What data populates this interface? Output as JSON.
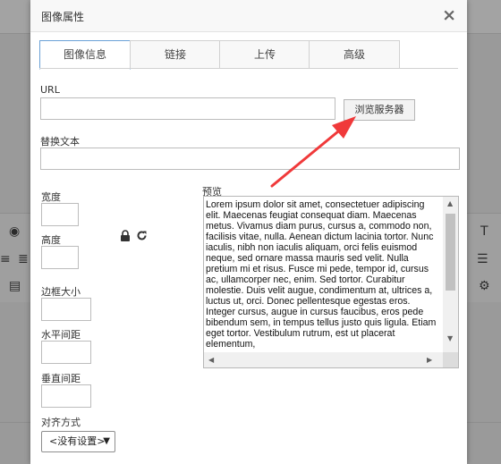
{
  "dialog": {
    "title": "图像属性",
    "close_glyph": "×"
  },
  "tabs": [
    {
      "label": "图像信息",
      "active": true
    },
    {
      "label": "链接",
      "active": false
    },
    {
      "label": "上传",
      "active": false
    },
    {
      "label": "高级",
      "active": false
    }
  ],
  "form": {
    "url_label": "URL",
    "url_value": "",
    "browse_button": "浏览服务器",
    "alt_label": "替换文本",
    "alt_value": "",
    "width_label": "宽度",
    "height_label": "高度",
    "border_label": "边框大小",
    "hspace_label": "水平间距",
    "vspace_label": "垂直间距",
    "align_label": "对齐方式",
    "align_selected": "<没有设置>",
    "preview_label": "预览",
    "preview_text": "Lorem ipsum dolor sit amet, consectetuer adipiscing elit. Maecenas feugiat consequat diam. Maecenas metus. Vivamus diam purus, cursus a, commodo non, facilisis vitae, nulla. Aenean dictum lacinia tortor. Nunc iaculis, nibh non iaculis aliquam, orci felis euismod neque, sed ornare massa mauris sed velit. Nulla pretium mi et risus. Fusce mi pede, tempor id, cursus ac, ullamcorper nec, enim. Sed tortor. Curabitur molestie. Duis velit augue, condimentum at, ultrices a, luctus ut, orci. Donec pellentesque egestas eros. Integer cursus, augue in cursus faucibus, eros pede bibendum sem, in tempus tellus justo quis ligula. Etiam eget tortor. Vestibulum rutrum, est ut placerat elementum,"
  },
  "icons": {
    "lock": "lock-icon",
    "reset": "refresh-icon"
  },
  "colors": {
    "arrow": "#f0393a",
    "active_tab_border": "#6aa1d6"
  }
}
